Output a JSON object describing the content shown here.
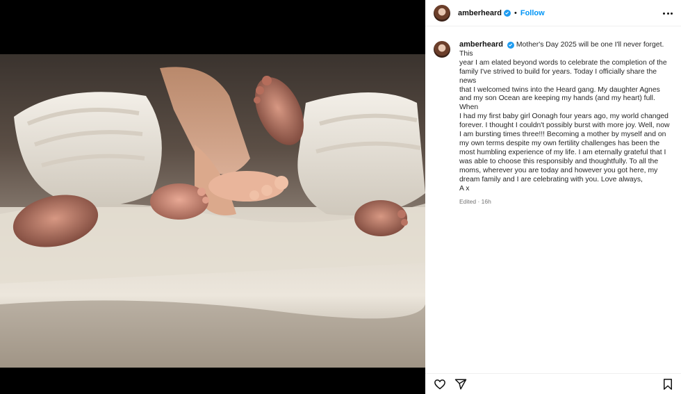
{
  "post": {
    "username": "amberheard",
    "separator": "•",
    "follow_label": "Follow",
    "verified": true,
    "caption_lines": [
      "Mother's Day 2025 will be one I'll never forget. This",
      "year I am elated beyond words to celebrate the completion of the",
      "family I've strived to build for years. Today I officially share the news",
      "that I welcomed twins into the Heard gang. My daughter Agnes",
      "and my son Ocean are keeping my hands (and my heart) full. When",
      "I had my first baby girl Oonagh four years ago, my world changed",
      "forever. I thought I couldn't possibly burst with more joy. Well, now",
      "I am bursting times three!!! Becoming a mother by myself and on",
      "my own terms despite my own fertility challenges has been the",
      "most humbling experience of my life. I am eternally grateful that I",
      "was able to choose this responsibly and thoughtfully. To all the",
      "moms, wherever you are today and however you got here, my",
      "dream family and I are celebrating with you. Love always,",
      "A x"
    ],
    "meta": "Edited · 16h"
  },
  "icons": {
    "like": "heart-icon",
    "share": "send-icon",
    "save": "bookmark-icon",
    "more": "more-options-icon"
  },
  "colors": {
    "link_blue": "#0095f6",
    "verified_blue": "#1d9bf0",
    "text": "#262626",
    "meta": "#737373"
  }
}
